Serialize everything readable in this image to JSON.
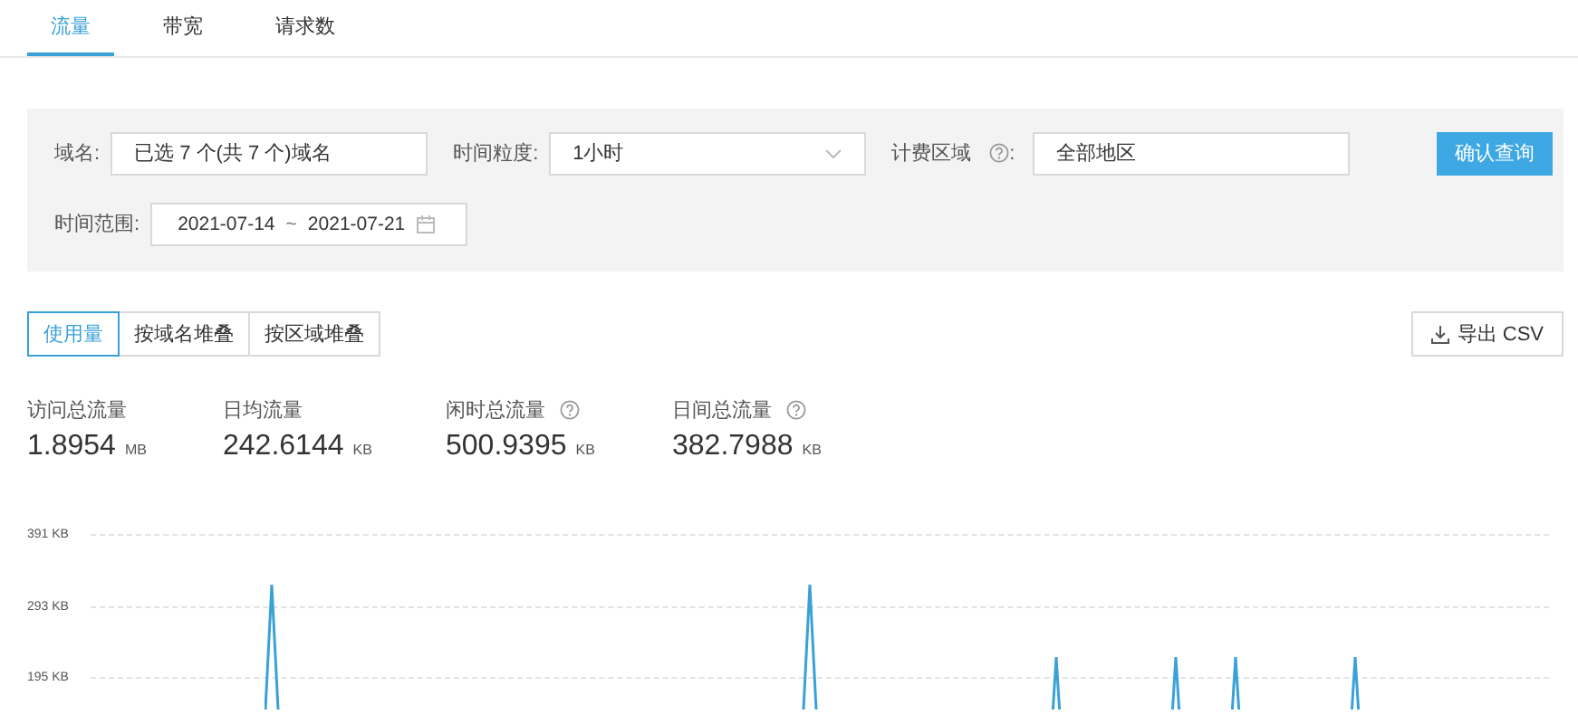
{
  "tabs": [
    {
      "label": "流量",
      "selected": true
    },
    {
      "label": "带宽",
      "selected": false
    },
    {
      "label": "请求数",
      "selected": false
    }
  ],
  "filters": {
    "domain": {
      "label": "域名:",
      "value": "已选 7 个(共 7 个)域名"
    },
    "granularity": {
      "label": "时间粒度:",
      "value": "1小时"
    },
    "billing_region": {
      "label": "计费区域",
      "suffix": ":",
      "value": "全部地区"
    },
    "query_button": "确认查询",
    "time_range": {
      "label": "时间范围:",
      "start": "2021-07-14",
      "separator": "~",
      "end": "2021-07-21"
    }
  },
  "view_modes": [
    {
      "label": "使用量",
      "selected": true
    },
    {
      "label": "按域名堆叠",
      "selected": false
    },
    {
      "label": "按区域堆叠",
      "selected": false
    }
  ],
  "export_button": "导出 CSV",
  "stats": [
    {
      "label": "访问总流量",
      "value": "1.8954",
      "unit": "MB",
      "help": false
    },
    {
      "label": "日均流量",
      "value": "242.6144",
      "unit": "KB",
      "help": false
    },
    {
      "label": "闲时总流量",
      "value": "500.9395",
      "unit": "KB",
      "help": true
    },
    {
      "label": "日间总流量",
      "value": "382.7988",
      "unit": "KB",
      "help": true
    }
  ],
  "chart": {
    "y_labels": [
      "391 KB",
      "293 KB",
      "195 KB"
    ]
  }
}
